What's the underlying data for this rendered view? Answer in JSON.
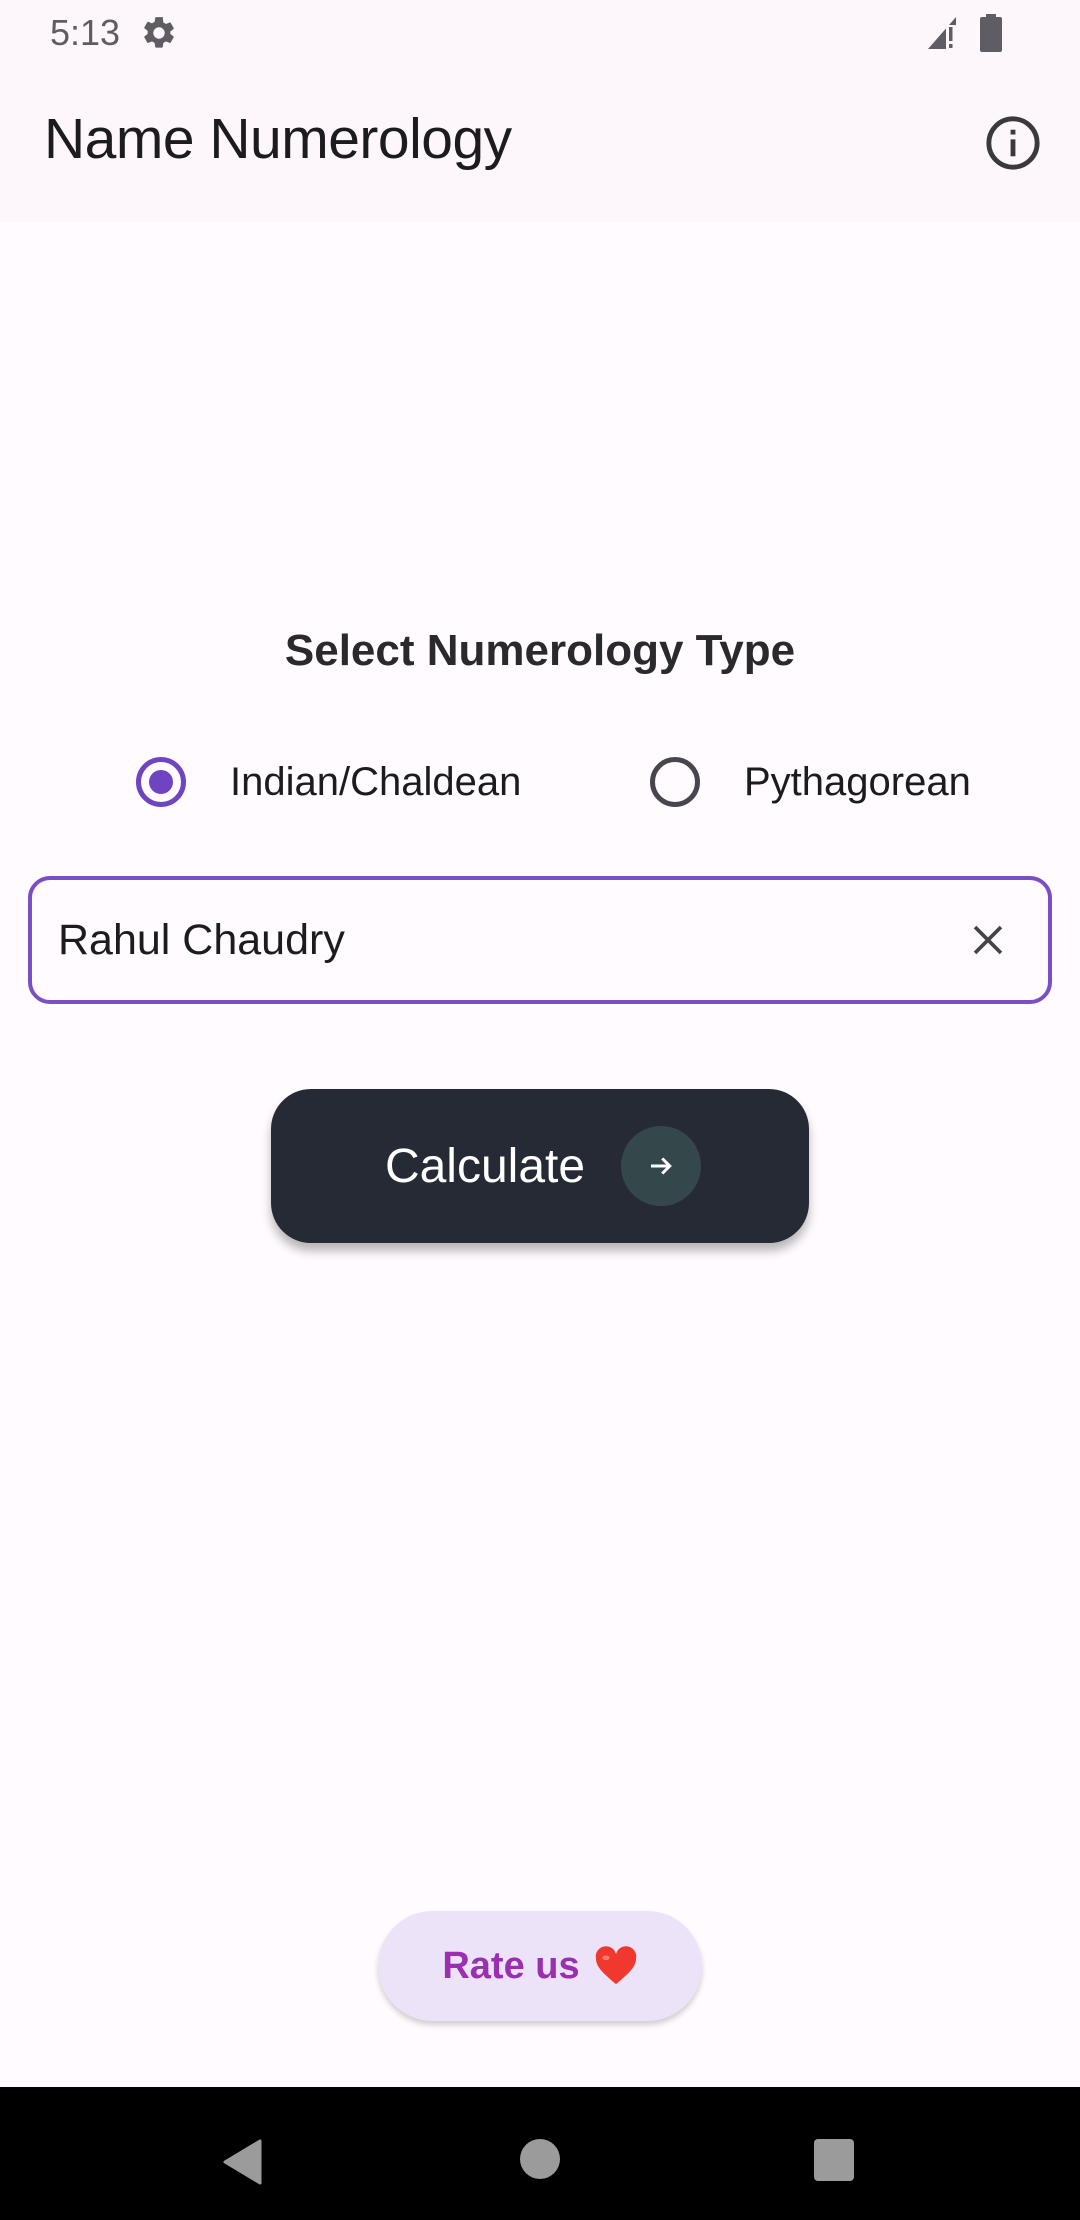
{
  "status_bar": {
    "time": "5:13",
    "icons": [
      "gear-icon",
      "signal-icon",
      "battery-icon"
    ]
  },
  "app_bar": {
    "title": "Name Numerology",
    "info_icon": "info-icon"
  },
  "main": {
    "heading": "Select Numerology Type",
    "numerology_types": [
      {
        "label": "Indian/Chaldean",
        "selected": true
      },
      {
        "label": "Pythagorean",
        "selected": false
      }
    ],
    "name_input": {
      "value": "Rahul Chaudry",
      "clear_icon": "close-icon"
    },
    "calculate_button": {
      "label": "Calculate",
      "icon": "arrow-right-icon"
    }
  },
  "footer": {
    "rate_button": {
      "label": "Rate us",
      "icon": "heart-icon"
    }
  },
  "nav_bar": {
    "buttons": [
      "back",
      "home",
      "recents"
    ]
  },
  "colors": {
    "accent": "#6e44c0",
    "calculate_bg": "#262a35",
    "rate_bg": "#ece3f8",
    "rate_text": "#9a2fb0"
  }
}
